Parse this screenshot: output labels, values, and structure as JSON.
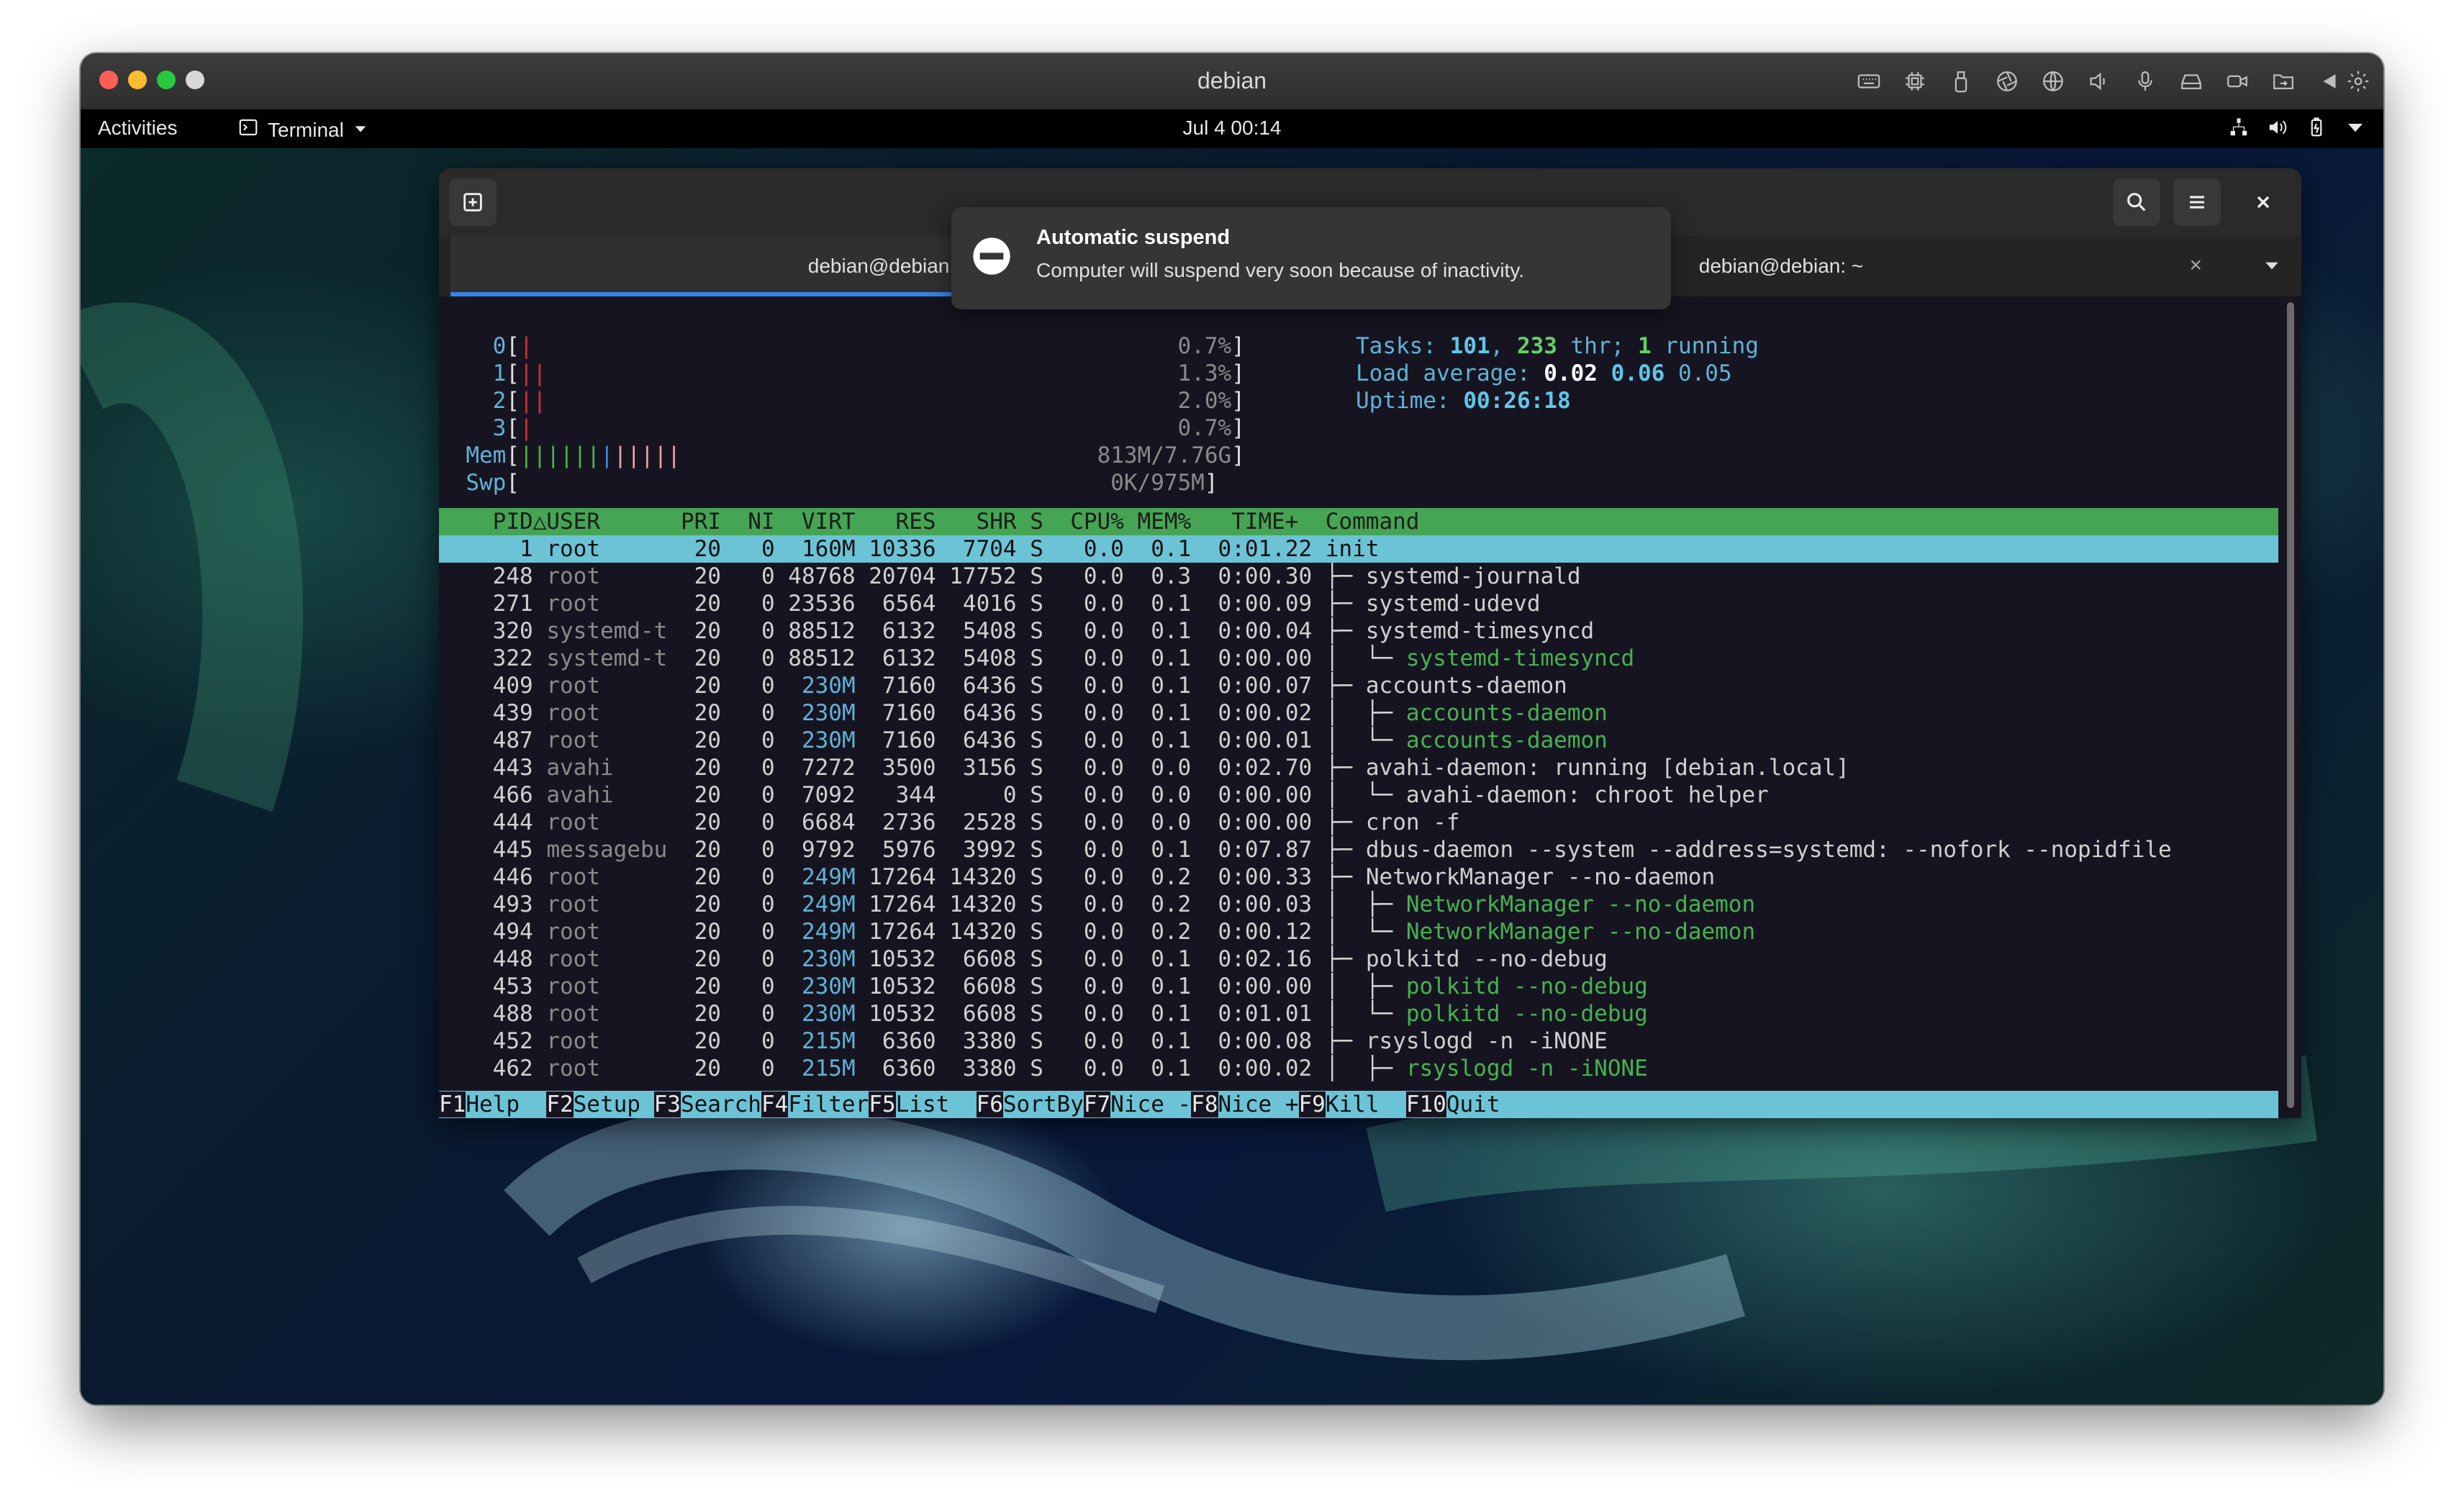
{
  "vm": {
    "title": "debian",
    "toolbar_icons": [
      "keyboard-icon",
      "cpu-icon",
      "usb-icon",
      "camera-lens-icon",
      "globe-icon",
      "speaker-icon",
      "microphone-icon",
      "disk-icon",
      "video-camera-icon",
      "shared-folder-icon",
      "back-icon",
      "settings-icon"
    ],
    "traffic_light_colors": {
      "close": "#fe5f57",
      "minimize": "#febc2e",
      "zoom": "#28c840",
      "fourth": "#d8d8d8"
    }
  },
  "gnome": {
    "activities": "Activities",
    "app_name": "Terminal",
    "clock": "Jul 4  00:14"
  },
  "notification": {
    "title": "Automatic suspend",
    "body": "Computer will suspend very soon because of inactivity."
  },
  "terminal": {
    "tabs": [
      {
        "title": "debian@debian: ~",
        "active": true
      },
      {
        "title": "debian@debian: ~",
        "active": false
      }
    ],
    "close_glyph": "×"
  },
  "htop": {
    "cpus": [
      {
        "label": "0",
        "bar": "|",
        "value": "0.7%"
      },
      {
        "label": "1",
        "bar": "||",
        "value": "1.3%"
      },
      {
        "label": "2",
        "bar": "||",
        "value": "2.0%"
      },
      {
        "label": "3",
        "bar": "|",
        "value": "0.7%"
      }
    ],
    "mem": {
      "label": "Mem",
      "bar_green": "||||||",
      "bar_blue": "|",
      "bar_yellow": "|||||",
      "value": "813M/7.76G"
    },
    "swp": {
      "label": "Swp",
      "value": "0K/975M"
    },
    "tasks": {
      "label": "Tasks: ",
      "count": "101",
      "sep": ", ",
      "threads": "233",
      "thr_label": " thr; ",
      "running": "1",
      "running_label": " running"
    },
    "load": {
      "label": "Load average: ",
      "one": "0.02",
      "five": "0.06",
      "fifteen": "0.05"
    },
    "uptime": {
      "label": "Uptime: ",
      "value": "00:26:18"
    },
    "header": "    PID△USER      PRI  NI  VIRT   RES   SHR S  CPU% MEM%   TIME+  Command",
    "rows": [
      {
        "pid": "1",
        "user": "root",
        "pri": "20",
        "ni": "0",
        "virt": "160M",
        "res": "10336",
        "shr": "7704",
        "s": "S",
        "cpu": "0.0",
        "mem": "0.1",
        "time": "0:01.22",
        "tree": "",
        "cmd": "init",
        "child": false,
        "selected": true
      },
      {
        "pid": "248",
        "user": "root",
        "pri": "20",
        "ni": "0",
        "virt": "48768",
        "res": "20704",
        "shr": "17752",
        "s": "S",
        "cpu": "0.0",
        "mem": "0.3",
        "time": "0:00.30",
        "tree": "├─ ",
        "cmd": "systemd-journald",
        "child": false
      },
      {
        "pid": "271",
        "user": "root",
        "pri": "20",
        "ni": "0",
        "virt": "23536",
        "res": "6564",
        "shr": "4016",
        "s": "S",
        "cpu": "0.0",
        "mem": "0.1",
        "time": "0:00.09",
        "tree": "├─ ",
        "cmd": "systemd-udevd",
        "child": false
      },
      {
        "pid": "320",
        "user": "systemd-t",
        "pri": "20",
        "ni": "0",
        "virt": "88512",
        "res": "6132",
        "shr": "5408",
        "s": "S",
        "cpu": "0.0",
        "mem": "0.1",
        "time": "0:00.04",
        "tree": "├─ ",
        "cmd": "systemd-timesyncd",
        "child": false
      },
      {
        "pid": "322",
        "user": "systemd-t",
        "pri": "20",
        "ni": "0",
        "virt": "88512",
        "res": "6132",
        "shr": "5408",
        "s": "S",
        "cpu": "0.0",
        "mem": "0.1",
        "time": "0:00.00",
        "tree": "│  └─ ",
        "cmd": "systemd-timesyncd",
        "child": true
      },
      {
        "pid": "409",
        "user": "root",
        "pri": "20",
        "ni": "0",
        "virt": "230M",
        "res": "7160",
        "shr": "6436",
        "s": "S",
        "cpu": "0.0",
        "mem": "0.1",
        "time": "0:00.07",
        "tree": "├─ ",
        "cmd": "accounts-daemon",
        "child": false
      },
      {
        "pid": "439",
        "user": "root",
        "pri": "20",
        "ni": "0",
        "virt": "230M",
        "res": "7160",
        "shr": "6436",
        "s": "S",
        "cpu": "0.0",
        "mem": "0.1",
        "time": "0:00.02",
        "tree": "│  ├─ ",
        "cmd": "accounts-daemon",
        "child": true
      },
      {
        "pid": "487",
        "user": "root",
        "pri": "20",
        "ni": "0",
        "virt": "230M",
        "res": "7160",
        "shr": "6436",
        "s": "S",
        "cpu": "0.0",
        "mem": "0.1",
        "time": "0:00.01",
        "tree": "│  └─ ",
        "cmd": "accounts-daemon",
        "child": true
      },
      {
        "pid": "443",
        "user": "avahi",
        "pri": "20",
        "ni": "0",
        "virt": "7272",
        "res": "3500",
        "shr": "3156",
        "s": "S",
        "cpu": "0.0",
        "mem": "0.0",
        "time": "0:02.70",
        "tree": "├─ ",
        "cmd": "avahi-daemon: running [debian.local]",
        "child": false
      },
      {
        "pid": "466",
        "user": "avahi",
        "pri": "20",
        "ni": "0",
        "virt": "7092",
        "res": "344",
        "shr": "0",
        "s": "S",
        "cpu": "0.0",
        "mem": "0.0",
        "time": "0:00.00",
        "tree": "│  └─ ",
        "cmd": "avahi-daemon: chroot helper",
        "child": false
      },
      {
        "pid": "444",
        "user": "root",
        "pri": "20",
        "ni": "0",
        "virt": "6684",
        "res": "2736",
        "shr": "2528",
        "s": "S",
        "cpu": "0.0",
        "mem": "0.0",
        "time": "0:00.00",
        "tree": "├─ ",
        "cmd": "cron -f",
        "child": false
      },
      {
        "pid": "445",
        "user": "messagebu",
        "pri": "20",
        "ni": "0",
        "virt": "9792",
        "res": "5976",
        "shr": "3992",
        "s": "S",
        "cpu": "0.0",
        "mem": "0.1",
        "time": "0:07.87",
        "tree": "├─ ",
        "cmd": "dbus-daemon --system --address=systemd: --nofork --nopidfile",
        "child": false
      },
      {
        "pid": "446",
        "user": "root",
        "pri": "20",
        "ni": "0",
        "virt": "249M",
        "res": "17264",
        "shr": "14320",
        "s": "S",
        "cpu": "0.0",
        "mem": "0.2",
        "time": "0:00.33",
        "tree": "├─ ",
        "cmd": "NetworkManager --no-daemon",
        "child": false
      },
      {
        "pid": "493",
        "user": "root",
        "pri": "20",
        "ni": "0",
        "virt": "249M",
        "res": "17264",
        "shr": "14320",
        "s": "S",
        "cpu": "0.0",
        "mem": "0.2",
        "time": "0:00.03",
        "tree": "│  ├─ ",
        "cmd": "NetworkManager --no-daemon",
        "child": true
      },
      {
        "pid": "494",
        "user": "root",
        "pri": "20",
        "ni": "0",
        "virt": "249M",
        "res": "17264",
        "shr": "14320",
        "s": "S",
        "cpu": "0.0",
        "mem": "0.2",
        "time": "0:00.12",
        "tree": "│  └─ ",
        "cmd": "NetworkManager --no-daemon",
        "child": true
      },
      {
        "pid": "448",
        "user": "root",
        "pri": "20",
        "ni": "0",
        "virt": "230M",
        "res": "10532",
        "shr": "6608",
        "s": "S",
        "cpu": "0.0",
        "mem": "0.1",
        "time": "0:02.16",
        "tree": "├─ ",
        "cmd": "polkitd --no-debug",
        "child": false
      },
      {
        "pid": "453",
        "user": "root",
        "pri": "20",
        "ni": "0",
        "virt": "230M",
        "res": "10532",
        "shr": "6608",
        "s": "S",
        "cpu": "0.0",
        "mem": "0.1",
        "time": "0:00.00",
        "tree": "│  ├─ ",
        "cmd": "polkitd --no-debug",
        "child": true
      },
      {
        "pid": "488",
        "user": "root",
        "pri": "20",
        "ni": "0",
        "virt": "230M",
        "res": "10532",
        "shr": "6608",
        "s": "S",
        "cpu": "0.0",
        "mem": "0.1",
        "time": "0:01.01",
        "tree": "│  └─ ",
        "cmd": "polkitd --no-debug",
        "child": true
      },
      {
        "pid": "452",
        "user": "root",
        "pri": "20",
        "ni": "0",
        "virt": "215M",
        "res": "6360",
        "shr": "3380",
        "s": "S",
        "cpu": "0.0",
        "mem": "0.1",
        "time": "0:00.08",
        "tree": "├─ ",
        "cmd": "rsyslogd -n -iNONE",
        "child": false
      },
      {
        "pid": "462",
        "user": "root",
        "pri": "20",
        "ni": "0",
        "virt": "215M",
        "res": "6360",
        "shr": "3380",
        "s": "S",
        "cpu": "0.0",
        "mem": "0.1",
        "time": "0:00.02",
        "tree": "│  ├─ ",
        "cmd": "rsyslogd -n -iNONE",
        "child": true
      }
    ],
    "fkeys": [
      {
        "key": "F1",
        "label": "Help  "
      },
      {
        "key": "F2",
        "label": "Setup "
      },
      {
        "key": "F3",
        "label": "Search"
      },
      {
        "key": "F4",
        "label": "Filter"
      },
      {
        "key": "F5",
        "label": "List  "
      },
      {
        "key": "F6",
        "label": "SortBy"
      },
      {
        "key": "F7",
        "label": "Nice -"
      },
      {
        "key": "F8",
        "label": "Nice +"
      },
      {
        "key": "F9",
        "label": "Kill  "
      },
      {
        "key": "F10",
        "label": "Quit"
      }
    ]
  }
}
